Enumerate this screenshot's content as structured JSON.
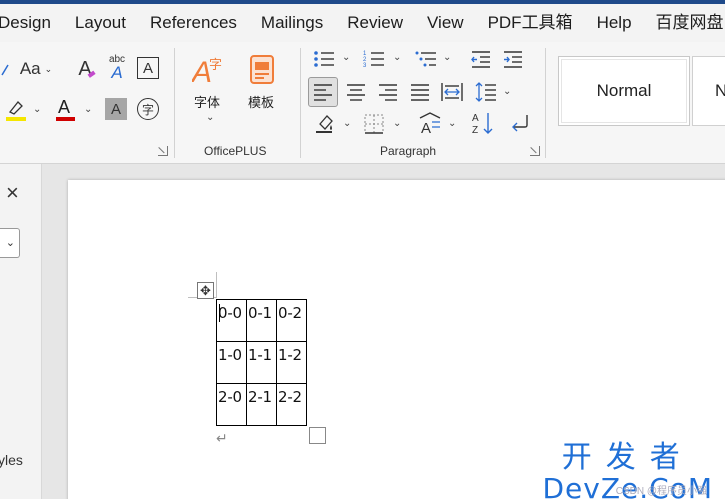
{
  "menu": {
    "tabs": [
      "Design",
      "Layout",
      "References",
      "Mailings",
      "Review",
      "View",
      "PDF工具箱",
      "Help",
      "百度网盘"
    ]
  },
  "ribbon": {
    "font_group": {
      "change_case": "Aa",
      "clear_formatting": "A",
      "phonetic": "abc",
      "border_char": "A",
      "highlight_color": "#f5e600",
      "font_color": "#d00000",
      "shading_char": "A",
      "enclose_char": "字"
    },
    "officeplus": {
      "label": "OfficePLUS",
      "font_button": "字体",
      "template_button": "模板"
    },
    "paragraph": {
      "label": "Paragraph"
    },
    "styles": {
      "normal": "Normal",
      "next": "N"
    }
  },
  "pane": {
    "close": "×",
    "label": "yles"
  },
  "document": {
    "table": [
      [
        "0-0",
        "0-1",
        "0-2"
      ],
      [
        "1-0",
        "1-1",
        "1-2"
      ],
      [
        "2-0",
        "2-1",
        "2-2"
      ]
    ],
    "paragraph_mark": "↵"
  },
  "watermark": {
    "line1": "开发者",
    "line2": "DevZe.CoM",
    "line3": "CSDN @程序员小强"
  }
}
